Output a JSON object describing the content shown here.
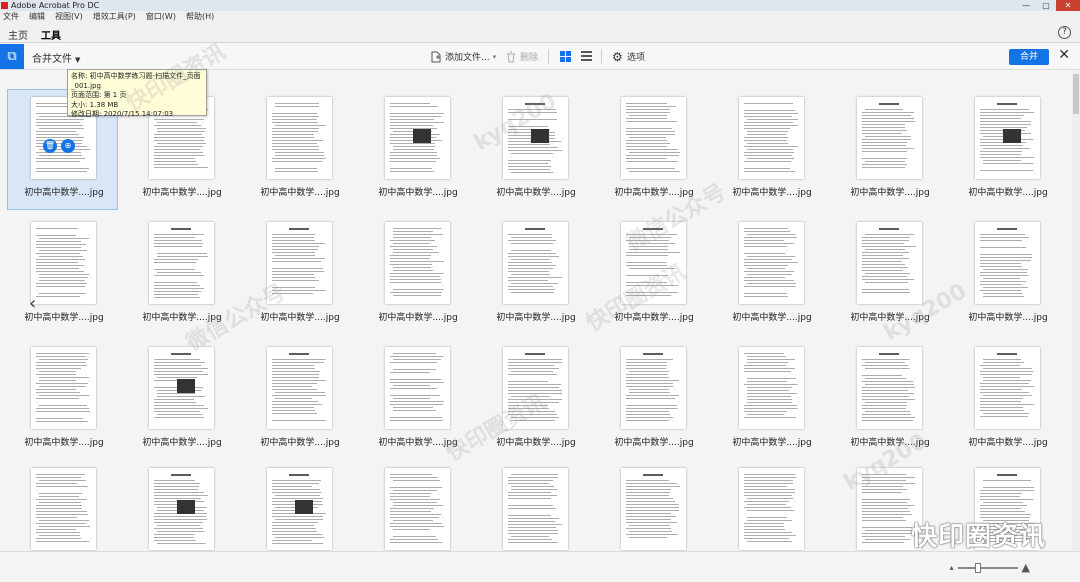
{
  "window": {
    "title": "Adobe Acrobat Pro DC"
  },
  "menu": [
    "文件",
    "编辑",
    "视图(V)",
    "增效工具(P)",
    "窗口(W)",
    "帮助(H)"
  ],
  "tabs": {
    "home": "主页",
    "tools": "工具"
  },
  "toolbar": {
    "title": "合并文件",
    "add_files": "添加文件...",
    "delete": "删除",
    "options": "选项",
    "merge": "合并"
  },
  "thumb_label": "初中高中数学....jpg",
  "tooltip": {
    "name": "名称: 初中高中数学练习题-扫描文件_页面_001.jpg",
    "page_range": "页面范围: 第 1 页",
    "size": "大小: 1.38 MB",
    "modified": "修改日期: 2020/7/15 14:07:03"
  },
  "watermarks": {
    "text1": "kyq200",
    "text2": "快印圈资讯",
    "text3": "微信公众号",
    "brand": "快印圈资讯"
  },
  "colors": {
    "accent": "#1473e6"
  }
}
